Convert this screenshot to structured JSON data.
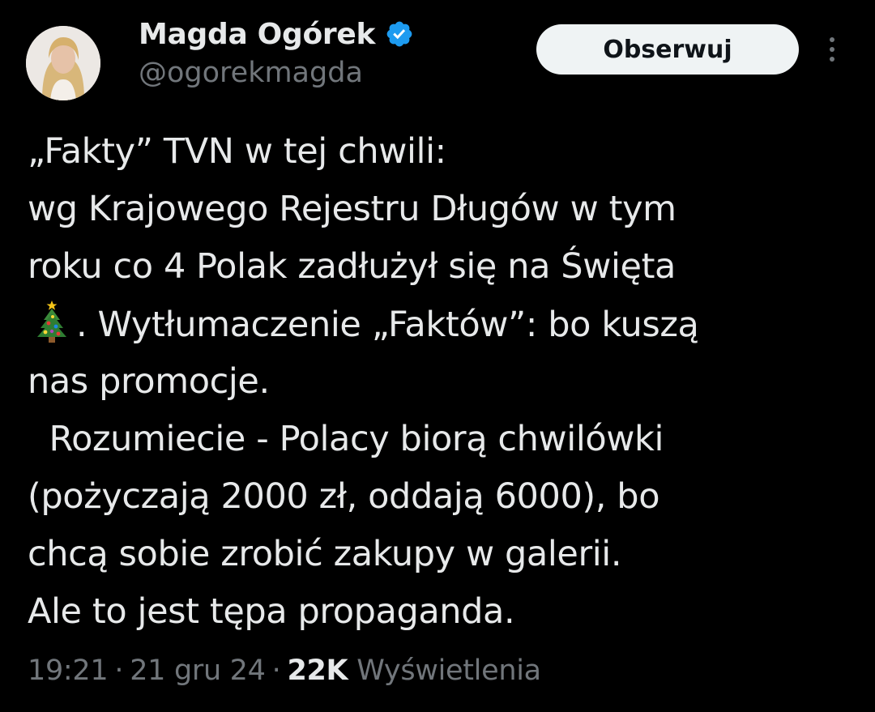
{
  "author": {
    "display_name": "Magda Ogórek",
    "handle": "@ogorekmagda",
    "verified_icon": "verified-badge-icon",
    "verified_color": "#1d9bf0"
  },
  "actions": {
    "follow_label": "Obserwuj",
    "more_icon": "more-options-icon"
  },
  "tweet": {
    "lines": [
      "„Fakty” TVN w tej chwili:",
      "wg Krajowego Rejestru Długów w tym",
      "roku co 4 Polak zadłużył się na Święta",
      ". Wytłumaczenie „Faktów”: bo kuszą",
      "nas promocje.",
      "  Rozumiecie - Polacy biorą chwilówki",
      "(pożyczają 2000 zł, oddają 6000), bo",
      "chcą sobie zrobić zakupy w galerii.",
      "Ale to jest tępa propaganda."
    ],
    "emoji": "christmas-tree-icon"
  },
  "meta": {
    "time": "19:21",
    "separator": "·",
    "date": "21 gru 24",
    "views_count": "22K",
    "views_label": "Wyświetlenia"
  },
  "colors": {
    "background": "#000000",
    "text_primary": "#e7e9ea",
    "text_secondary": "#71767b",
    "button_bg": "#eff3f4",
    "button_text": "#0f1419"
  }
}
